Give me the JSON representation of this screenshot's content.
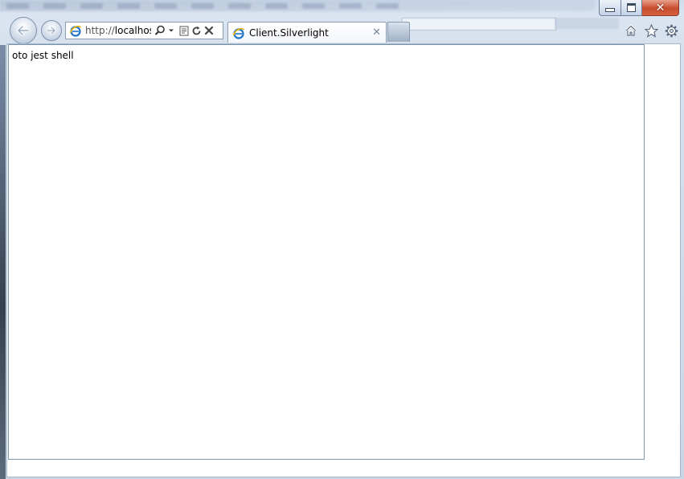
{
  "window": {
    "caption_buttons": {
      "minimize_icon": "minimize-icon",
      "maximize_icon": "maximize-icon",
      "close_icon": "close-icon",
      "close_color": "#c74b2d"
    }
  },
  "navigation": {
    "back_icon": "back-arrow-icon",
    "forward_icon": "forward-arrow-icon"
  },
  "address_bar": {
    "scheme": "http://",
    "host": "localhost:",
    "buttons": [
      "search-icon",
      "dropdown-arrow-icon",
      "compatibility-view-icon",
      "refresh-icon",
      "stop-icon"
    ]
  },
  "tabs": [
    {
      "title": "Client.Silverlight",
      "icon": "ie-page-icon",
      "active": true
    }
  ],
  "toolbar": {
    "icons": [
      "home-icon",
      "favorites-star-icon",
      "tools-gear-icon"
    ]
  },
  "content": {
    "silverlight_text": "oto jest shell",
    "accent": "#7b96ab"
  }
}
